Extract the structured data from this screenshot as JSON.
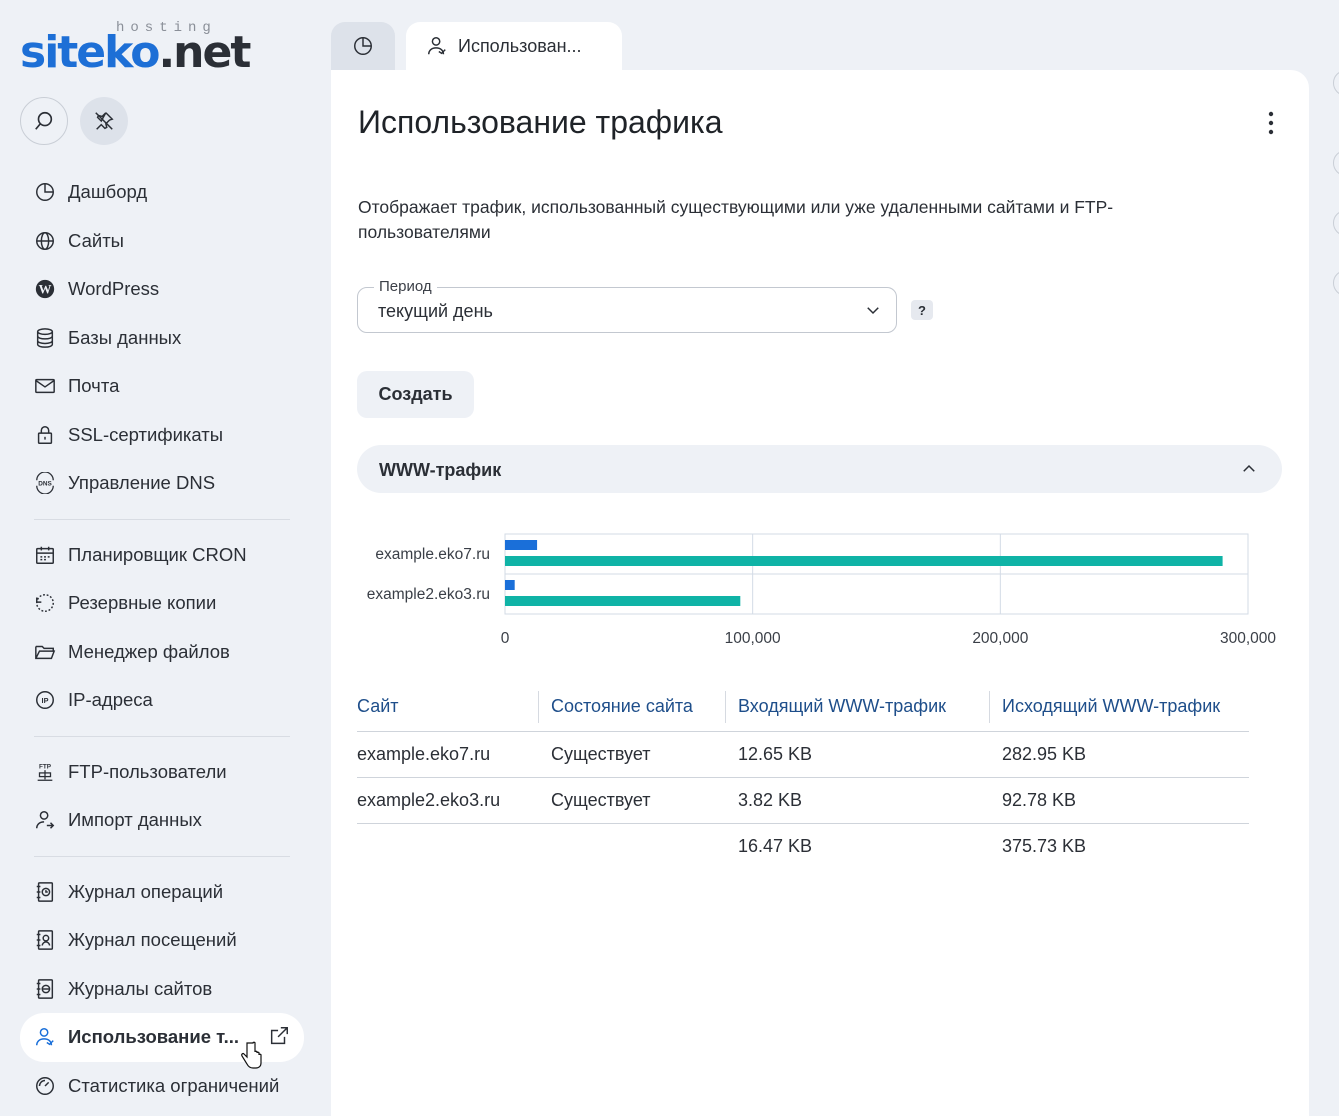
{
  "brand": {
    "hosting": "hosting",
    "name_blue": "siteko",
    "name_dark": ".net"
  },
  "tabs": {
    "active_label": "Использован..."
  },
  "sidebar": {
    "items": [
      {
        "label": "Дашборд"
      },
      {
        "label": "Сайты"
      },
      {
        "label": "WordPress"
      },
      {
        "label": "Базы данных"
      },
      {
        "label": "Почта"
      },
      {
        "label": "SSL-сертификаты"
      },
      {
        "label": "Управление DNS"
      },
      {
        "label": "Планировщик CRON"
      },
      {
        "label": "Резервные копии"
      },
      {
        "label": "Менеджер файлов"
      },
      {
        "label": "IP-адреса"
      },
      {
        "label": "FTP-пользователи"
      },
      {
        "label": "Импорт данных"
      },
      {
        "label": "Журнал операций"
      },
      {
        "label": "Журнал посещений"
      },
      {
        "label": "Журналы сайтов"
      },
      {
        "label": "Использование т..."
      },
      {
        "label": "Статистика ограничений"
      }
    ]
  },
  "page": {
    "title": "Использование трафика",
    "description": "Отображает трафик, использованный существующими или уже удаленными сайтами и FTP-пользователями",
    "period_label": "Период",
    "period_value": "текущий день",
    "help": "?",
    "create_button": "Создать",
    "section_title": "WWW-трафик"
  },
  "chart_data": {
    "type": "bar",
    "orientation": "horizontal",
    "categories": [
      "example.eko7.ru",
      "example2.eko3.ru"
    ],
    "series": [
      {
        "values": [
          12954,
          3912
        ],
        "color": "#1a6fd9"
      },
      {
        "values": [
          289741,
          95007
        ],
        "color": "#0fb3a6"
      }
    ],
    "xlim": [
      0,
      300000
    ],
    "xticks": [
      "0",
      "100,000",
      "200,000",
      "300,000"
    ],
    "grid": true
  },
  "table": {
    "headers": [
      "Сайт",
      "Состояние сайта",
      "Входящий WWW-трафик",
      "Исходящий WWW-трафик"
    ],
    "rows": [
      [
        "example.eko7.ru",
        "Существует",
        "12.65 KB",
        "282.95 KB"
      ],
      [
        "example2.eko3.ru",
        "Существует",
        "3.82 KB",
        "92.78 KB"
      ]
    ],
    "total": [
      "",
      "",
      "16.47 KB",
      "375.73 KB"
    ]
  }
}
